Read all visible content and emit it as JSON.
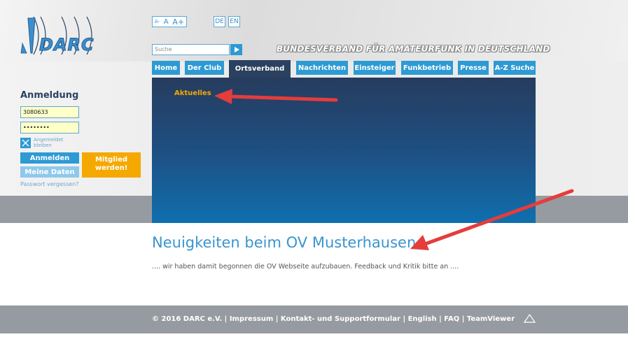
{
  "header": {
    "logo_text": "DARC",
    "logo_icon": "antenna-mast-icon",
    "slogan": "BUNDESVERBAND FÜR AMATEURFUNK IN DEUTSCHLAND",
    "font_sizes": [
      "A-",
      "A",
      "A+"
    ],
    "languages": [
      "DE",
      "EN"
    ],
    "search_placeholder": "Suche"
  },
  "nav": {
    "items": [
      "Home",
      "Der Club",
      "Ortsverband",
      "Nachrichten",
      "Einsteiger",
      "Funkbetrieb",
      "Presse",
      "A-Z Suche"
    ],
    "active": "Ortsverband"
  },
  "hero": {
    "submenu_link": "Aktuelles"
  },
  "login": {
    "title": "Anmeldung",
    "username_value": "3080633",
    "password_value": "••••••••",
    "remember_label_line1": "Angemeldet",
    "remember_label_line2": "bleiben",
    "login_button": "Anmelden",
    "my_data_button": "Meine Daten",
    "member_button_line1": "Mitglied",
    "member_button_line2": "werden!",
    "forgot_link": "Passwort vergessen?"
  },
  "content": {
    "headline": "Neuigkeiten beim OV Musterhausen",
    "text": ".... wir haben damit begonnen die OV Webseite aufzubauen. Feedback und Kritik bitte an ...."
  },
  "footer": {
    "copyright": "© 2016 DARC e.V.",
    "links": [
      "Impressum",
      "Kontakt- und Supportformular",
      "English",
      "FAQ",
      "TeamViewer"
    ],
    "separator": "|"
  },
  "colors": {
    "brand_blue": "#2d9ad4",
    "nav_active": "#2a4160",
    "accent_orange": "#f5a800",
    "annotation_red": "#e53c3c"
  }
}
